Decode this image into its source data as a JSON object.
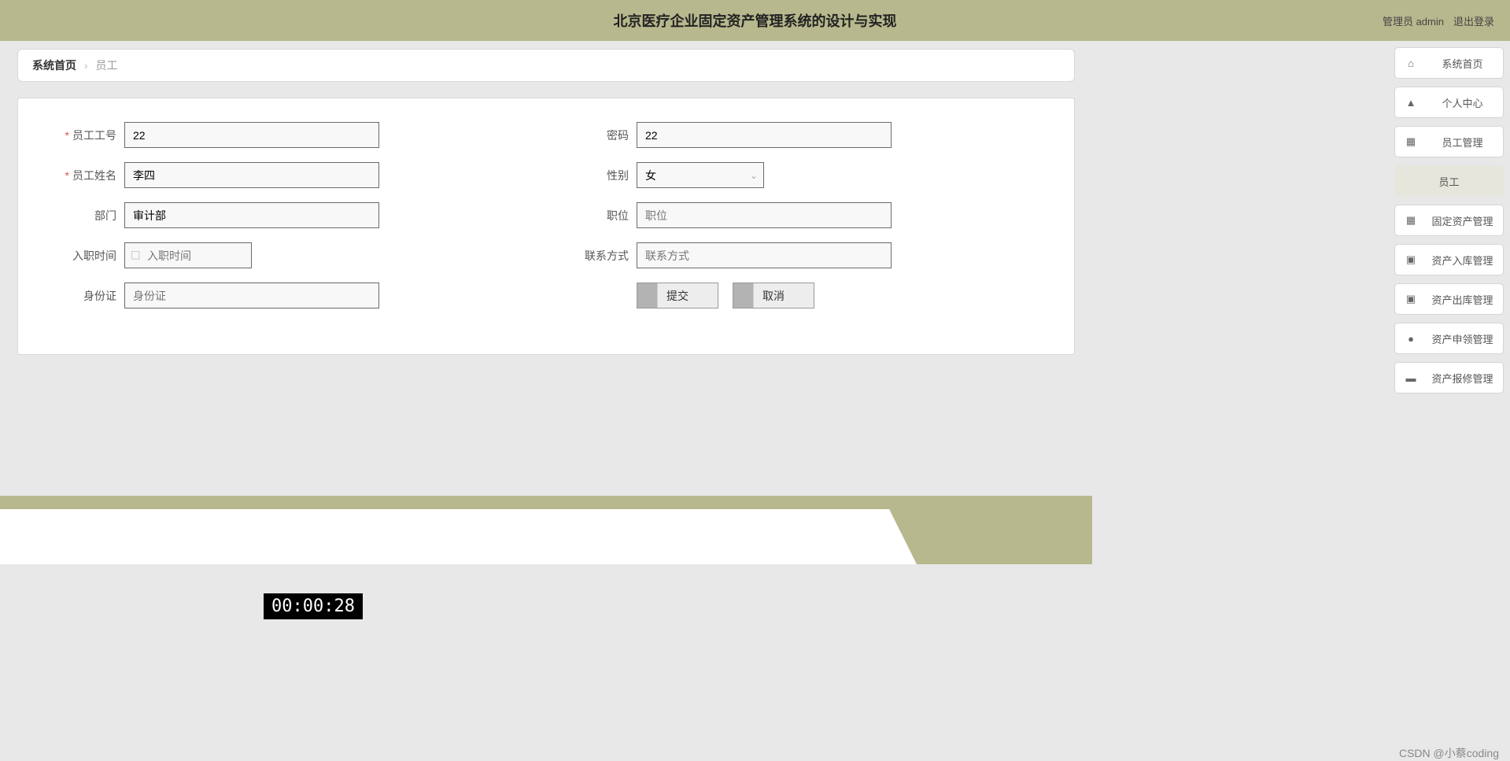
{
  "header": {
    "title": "北京医疗企业固定资产管理系统的设计与实现",
    "admin_label": "管理员 admin",
    "logout": "退出登录"
  },
  "breadcrumb": {
    "home": "系统首页",
    "current": "员工"
  },
  "form": {
    "emp_id_label": "员工工号",
    "emp_id_value": "22",
    "password_label": "密码",
    "password_value": "22",
    "emp_name_label": "员工姓名",
    "emp_name_value": "李四",
    "gender_label": "性别",
    "gender_value": "女",
    "dept_label": "部门",
    "dept_value": "审计部",
    "position_label": "职位",
    "position_placeholder": "职位",
    "hiredate_label": "入职时间",
    "hiredate_placeholder": "入职时间",
    "contact_label": "联系方式",
    "contact_placeholder": "联系方式",
    "idcard_label": "身份证",
    "idcard_placeholder": "身份证",
    "submit": "提交",
    "cancel": "取消"
  },
  "sidebar": {
    "home": "系统首页",
    "profile": "个人中心",
    "emp_mgmt": "员工管理",
    "emp": "员工",
    "asset_mgmt": "固定资产管理",
    "asset_in": "资产入库管理",
    "asset_out": "资产出库管理",
    "asset_apply": "资产申领管理",
    "asset_repair": "资产报修管理"
  },
  "timer": "00:00:28",
  "watermark": "CSDN @小蔡coding"
}
